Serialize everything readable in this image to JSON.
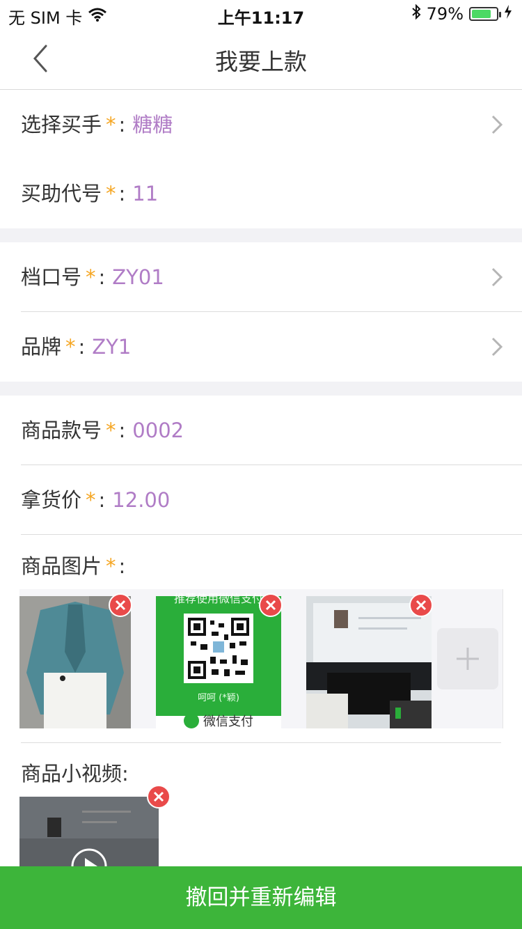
{
  "status_bar": {
    "carrier": "无 SIM 卡",
    "time": "上午11:17",
    "battery_percent": "79%",
    "battery_level": 0.79
  },
  "nav": {
    "title": "我要上款",
    "back_icon": "chevron-left-icon"
  },
  "form": {
    "buyer": {
      "label": "选择买手",
      "star": "*",
      "colon": ":",
      "value": "糖糖"
    },
    "assistant_code": {
      "label": "买助代号",
      "star": "*",
      "colon": ":",
      "value": "11"
    },
    "stall_no": {
      "label": "档口号",
      "star": "*",
      "colon": ":",
      "value": "ZY01"
    },
    "brand": {
      "label": "品牌",
      "star": "*",
      "colon": ":",
      "value": "ZY1"
    },
    "product_no": {
      "label": "商品款号",
      "star": "*",
      "colon": ":",
      "value": "0002"
    },
    "price": {
      "label": "拿货价",
      "star": "*",
      "colon": ":",
      "value": "12.00"
    },
    "images": {
      "label": "商品图片",
      "star": "*",
      "colon": ":"
    },
    "video": {
      "label": "商品小视频:"
    }
  },
  "images": {
    "qr_caption": "呵呵 (*颖)",
    "qr_footer": "微信支付",
    "qr_header": "推荐使用微信支付"
  },
  "colors": {
    "accent_value": "#b07cc6",
    "required_star": "#f5a623",
    "primary_button": "#3db53a",
    "delete": "#e94a4a"
  },
  "bottom_button": {
    "label": "撤回并重新编辑"
  }
}
